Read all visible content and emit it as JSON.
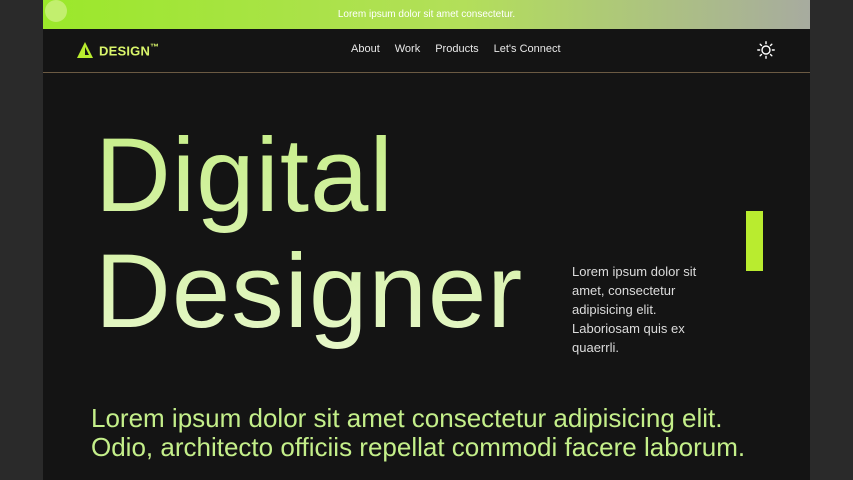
{
  "announcement": {
    "text": "Lorem ipsum dolor sit amet consectetur."
  },
  "brand": {
    "name": "DESIGN",
    "mark": "™"
  },
  "nav": {
    "links": [
      "About",
      "Work",
      "Products",
      "Let's Connect"
    ]
  },
  "hero": {
    "title_line1": "Digital",
    "title_line2": "Designer",
    "description": "Lorem ipsum dolor sit amet, consectetur adipisicing elit. Laboriosam quis ex quaerrli."
  },
  "lead": "Lorem ipsum dolor sit amet consectetur adipisicing elit. Odio, architecto officiis repellat commodi facere laborum.",
  "colors": {
    "accent": "#b9ec2f",
    "background": "#141414",
    "heading": "#d4f58c"
  },
  "icons": {
    "theme": "sun-icon",
    "logo": "triangle-logo-icon"
  }
}
